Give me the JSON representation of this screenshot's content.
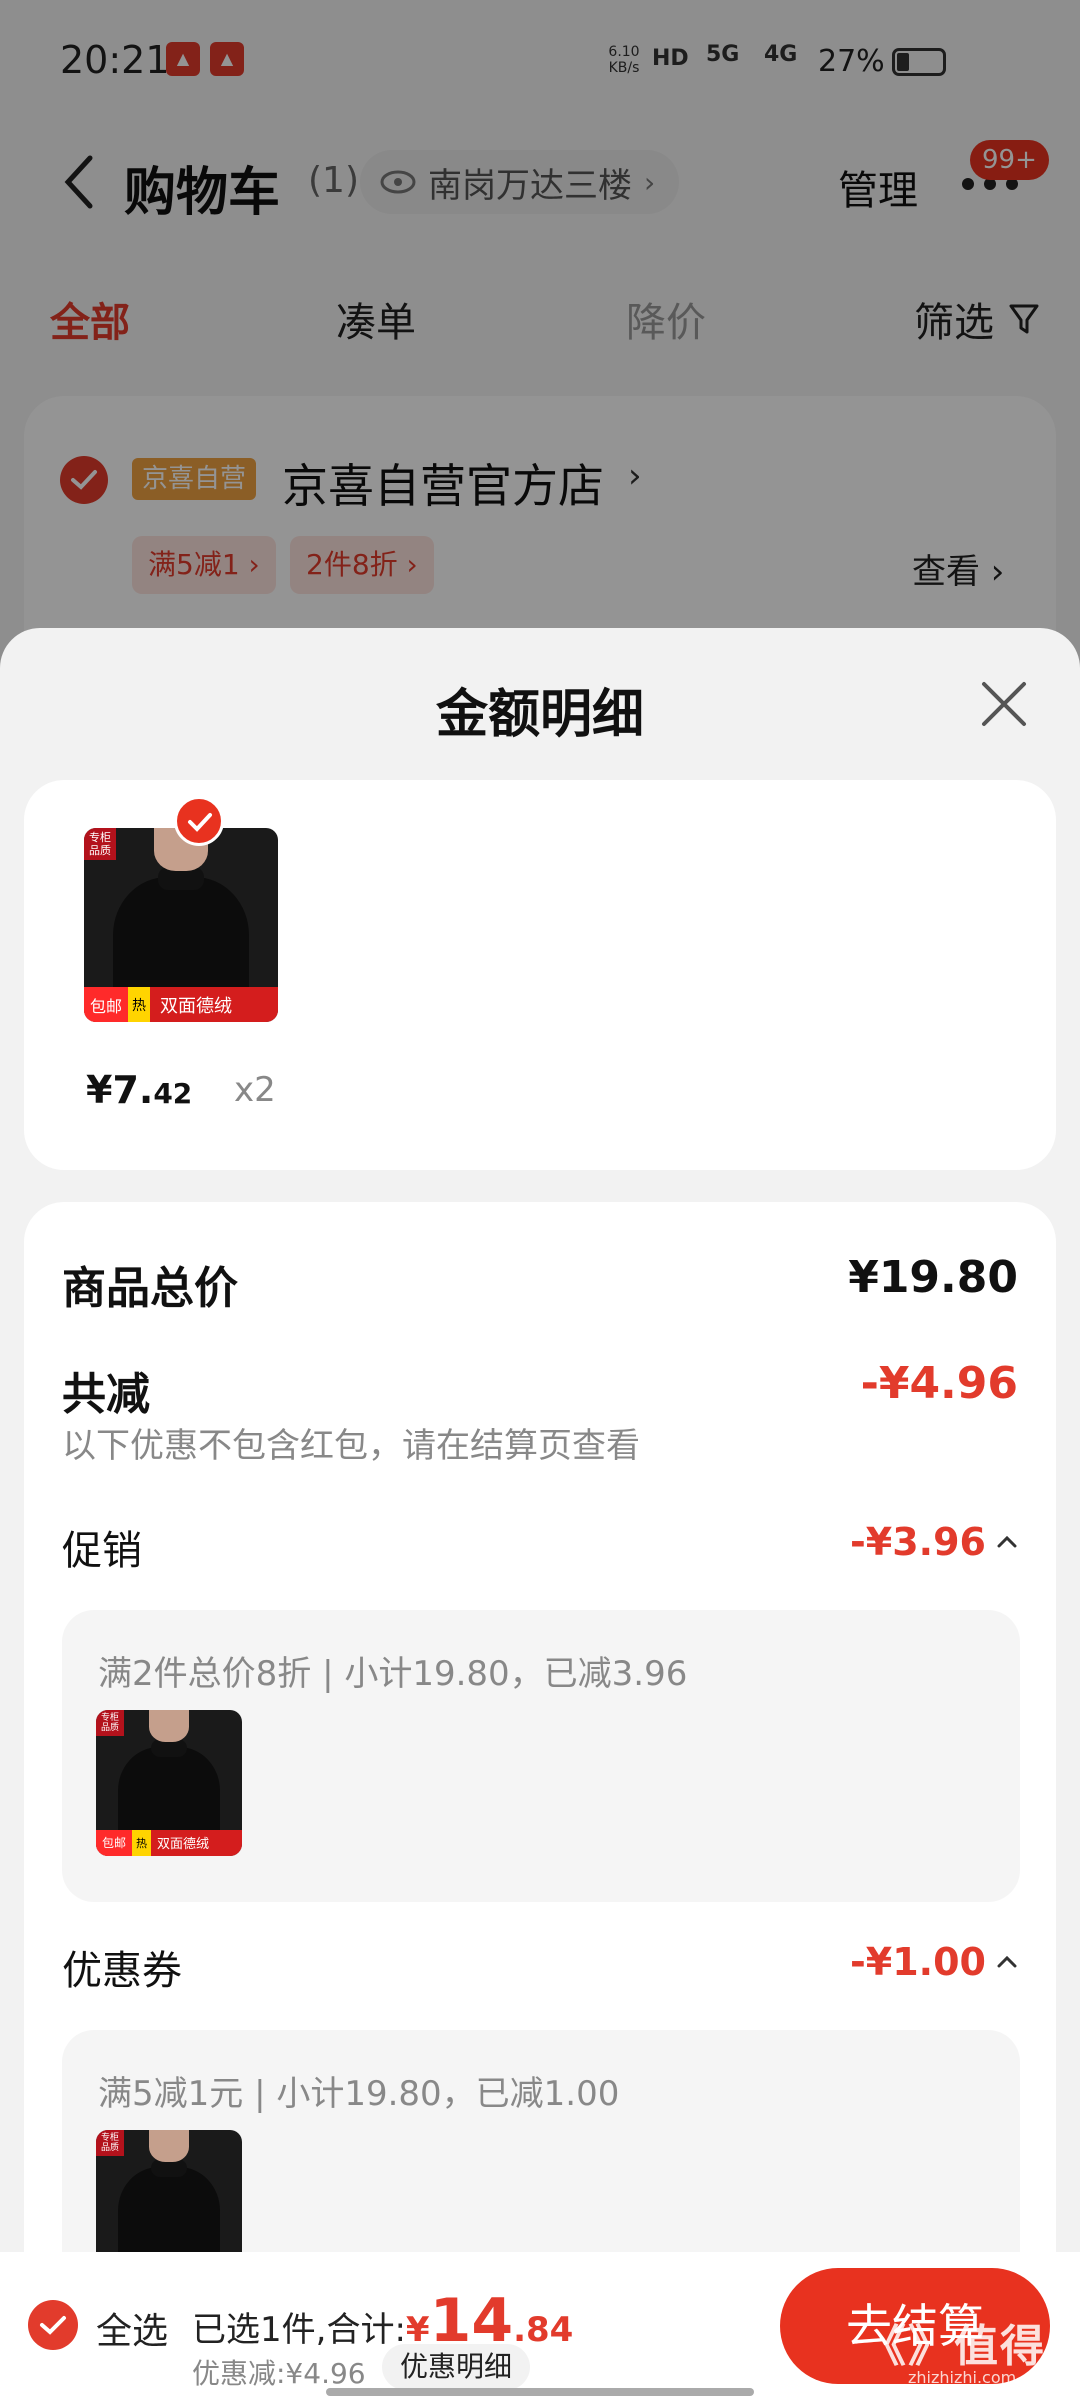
{
  "status_bar": {
    "time": "20:21",
    "net_speed": "6.10\nKB/s",
    "hd": "HD",
    "signal_5g": "5G",
    "signal_4g": "4G",
    "battery": "27%"
  },
  "header": {
    "title": "购物车",
    "count": "(1)",
    "location": "南岗万达三楼",
    "manage": "管理",
    "badge": "99+"
  },
  "tabs": [
    "全部",
    "凑单",
    "降价",
    "筛选"
  ],
  "store": {
    "tag": "京喜自营",
    "name": "京喜自营官方店",
    "promos": [
      "满5减1 ›",
      "2件8折 ›"
    ],
    "view": "查看 ›"
  },
  "sheet": {
    "title": "金额明细",
    "product": {
      "price_int": "¥7.",
      "price_dec": "42",
      "qty": "x2",
      "thumb": {
        "corner": "专柜\n品质",
        "b1": "包邮",
        "b2": "热",
        "b3": "双面德绒"
      }
    },
    "total_label": "商品总价",
    "total_value": "¥19.80",
    "reduce_label": "共减",
    "reduce_value": "-¥4.96",
    "reduce_note": "以下优惠不包含红包，请在结算页查看",
    "promo_label": "促销",
    "promo_value": "-¥3.96",
    "promo_detail": "满2件总价8折 | 小计19.80，已减3.96",
    "coupon_label": "优惠券",
    "coupon_value": "-¥1.00",
    "coupon_detail": "满5减1元 | 小计19.80，已减1.00"
  },
  "bottom": {
    "select_all": "全选",
    "summary": "已选1件,合计:",
    "yen": "¥",
    "total_int": "14",
    "total_dec": ".84",
    "discount": "优惠减:¥4.96",
    "detail_btn": "优惠明细",
    "checkout": "去结算",
    "watermark": "《》值得买",
    "watermark_sub": "zhizhizhi.com"
  },
  "colors": {
    "accent": "#e23b2c",
    "sheet_bg": "#f2f2f2"
  }
}
